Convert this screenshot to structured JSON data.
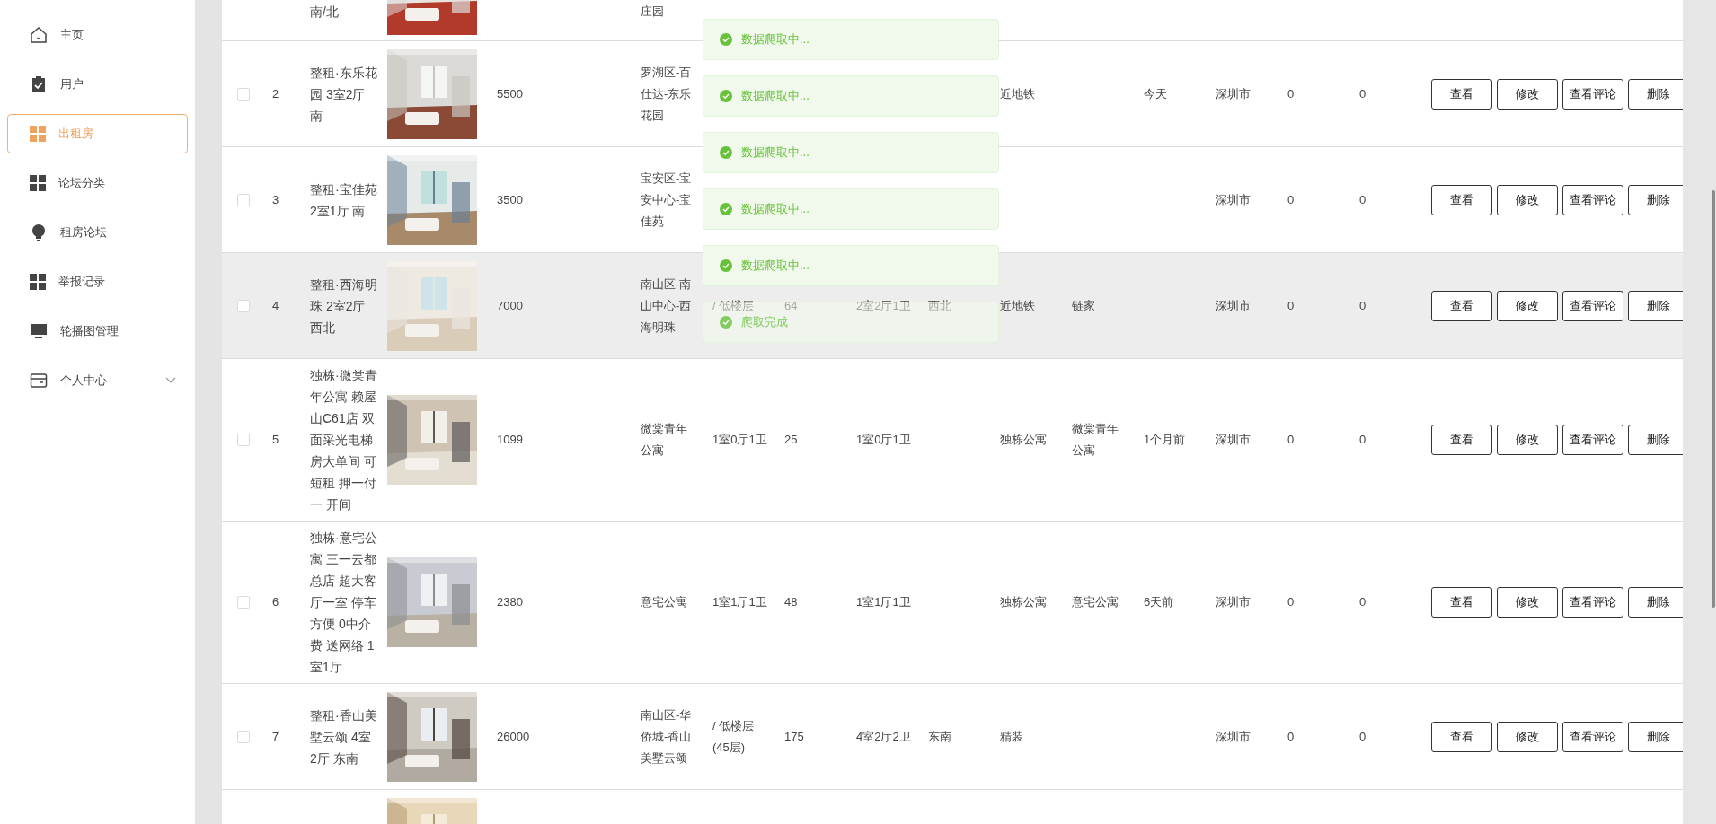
{
  "sidebar": {
    "items": [
      {
        "label": "主页",
        "selected": false
      },
      {
        "label": "用户",
        "selected": false
      },
      {
        "label": "出租房",
        "selected": true
      },
      {
        "label": "论坛分类",
        "selected": false
      },
      {
        "label": "租房论坛",
        "selected": false
      },
      {
        "label": "举报记录",
        "selected": false
      },
      {
        "label": "轮播图管理",
        "selected": false
      },
      {
        "label": "个人中心",
        "selected": false,
        "expanded": false
      }
    ]
  },
  "table": {
    "rows": [
      {
        "highlighted": false,
        "column_3": "南/北",
        "column_6": "庄园"
      },
      {
        "checked": false,
        "highlighted": false,
        "column_2": "2",
        "column_3": "整租·东乐花园 3室2厅南",
        "column_5": "5500",
        "column_6": "罗湖区-百仕达-东乐花园",
        "column_11": "近地铁",
        "column_13": "今天",
        "column_14": "深圳市",
        "column_15": "0",
        "column_16": "0",
        "actions": [
          "查看",
          "修改",
          "查看评论",
          "删除"
        ]
      },
      {
        "checked": false,
        "highlighted": false,
        "column_2": "3",
        "column_3": "整租·宝佳苑 2室1厅 南",
        "column_5": "3500",
        "column_6": "宝安区-宝安中心-宝佳苑",
        "column_14": "深圳市",
        "column_15": "0",
        "column_16": "0",
        "actions": [
          "查看",
          "修改",
          "查看评论",
          "删除"
        ]
      },
      {
        "checked": false,
        "highlighted": true,
        "column_2": "4",
        "column_3": "整租·西海明珠 2室2厅西北",
        "column_5": "7000",
        "column_6": "南山区-南山中心-西海明珠",
        "column_7": "/ 低楼层",
        "column_8": "64",
        "column_9": "2室2厅1卫",
        "column_10": "西北",
        "column_11": "近地铁",
        "column_12": "链家",
        "column_14": "深圳市",
        "column_15": "0",
        "column_16": "0",
        "actions": [
          "查看",
          "修改",
          "查看评论",
          "删除"
        ]
      },
      {
        "checked": false,
        "highlighted": false,
        "column_2": "5",
        "column_3": "独栋·微棠青年公寓 赖屋山C61店 双面采光电梯房大单间 可短租 押一付一 开间",
        "column_5": "1099",
        "column_6": "微棠青年公寓",
        "column_7": "1室0厅1卫",
        "column_8": "25",
        "column_9": "1室0厅1卫",
        "column_11": "独栋公寓",
        "column_12": "微棠青年公寓",
        "column_13": "1个月前",
        "column_14": "深圳市",
        "column_15": "0",
        "column_16": "0",
        "actions": [
          "查看",
          "修改",
          "查看评论",
          "删除"
        ]
      },
      {
        "checked": false,
        "highlighted": false,
        "column_2": "6",
        "column_3": "独栋·意宅公寓 三一云都总店 超大客厅一室 停车方便 0中介费 送网络 1室1厅",
        "column_5": "2380",
        "column_6": "意宅公寓",
        "column_7": "1室1厅1卫",
        "column_8": "48",
        "column_9": "1室1厅1卫",
        "column_11": "独栋公寓",
        "column_12": "意宅公寓",
        "column_13": "6天前",
        "column_14": "深圳市",
        "column_15": "0",
        "column_16": "0",
        "actions": [
          "查看",
          "修改",
          "查看评论",
          "删除"
        ]
      },
      {
        "checked": false,
        "highlighted": false,
        "column_2": "7",
        "column_3": "整租·香山美墅云颂 4室2厅 东南",
        "column_5": "26000",
        "column_6": "南山区-华侨城-香山美墅云颂",
        "column_7": "/ 低楼层 (45层)",
        "column_8": "175",
        "column_9": "4室2厅2卫",
        "column_10": "东南",
        "column_11": "精装",
        "column_14": "深圳市",
        "column_15": "0",
        "column_16": "0",
        "actions": [
          "查看",
          "修改",
          "查看评论",
          "删除"
        ]
      },
      {
        "highlighted": false
      }
    ]
  },
  "toasts": [
    {
      "text": "数据爬取中...",
      "kind": "success",
      "fading": false
    },
    {
      "text": "数据爬取中...",
      "kind": "success",
      "fading": false
    },
    {
      "text": "数据爬取中...",
      "kind": "success",
      "fading": false
    },
    {
      "text": "数据爬取中...",
      "kind": "success",
      "fading": false
    },
    {
      "text": "数据爬取中...",
      "kind": "success",
      "fading": false
    },
    {
      "text": "爬取完成",
      "kind": "success",
      "fading": true
    }
  ]
}
